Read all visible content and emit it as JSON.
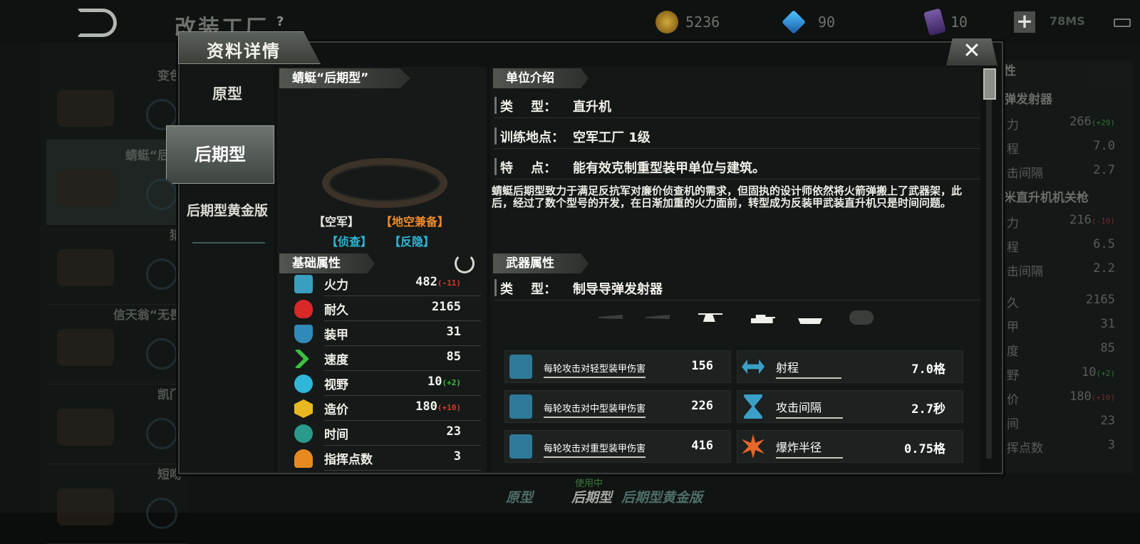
{
  "topbar": {
    "title": "改装工厂",
    "help": "?",
    "gold": "5236",
    "gems": "90",
    "cards": "10",
    "plus": "+",
    "ping": "78MS"
  },
  "bg_list": [
    {
      "name": "变色"
    },
    {
      "name": "蜻蜓“后期"
    },
    {
      "name": "猎"
    },
    {
      "name": "信天翁“无畏"
    },
    {
      "name": "凯门"
    },
    {
      "name": "短吻"
    }
  ],
  "bg_right": {
    "head1": "性",
    "head2": "弹发射器",
    "rows1": [
      {
        "label": "力",
        "value": "266",
        "delta": "(+29)",
        "delta_color": "green"
      },
      {
        "label": "程",
        "value": "7.0"
      },
      {
        "label": "击间隔",
        "value": "2.7"
      }
    ],
    "head3": "米直升机机关枪",
    "rows2": [
      {
        "label": "力",
        "value": "216",
        "delta": "(-10)",
        "delta_color": "red"
      },
      {
        "label": "程",
        "value": "6.5"
      },
      {
        "label": "击间隔",
        "value": "2.2"
      }
    ],
    "rows3": [
      {
        "label": "久",
        "value": "2165"
      },
      {
        "label": "甲",
        "value": "31"
      },
      {
        "label": "度",
        "value": "85"
      },
      {
        "label": "野",
        "value": "10",
        "delta": "(+2)",
        "delta_color": "green"
      },
      {
        "label": "价",
        "value": "180",
        "delta": "(+10)",
        "delta_color": "red"
      },
      {
        "label": "间",
        "value": "23"
      },
      {
        "label": "挥点数",
        "value": "3"
      }
    ]
  },
  "bottom": {
    "using": "使用中",
    "tab1": "原型",
    "tab2": "后期型",
    "tab3": "后期型黄金版"
  },
  "dialog": {
    "title": "资料详情",
    "close": "✕"
  },
  "variants": {
    "prototype": "原型",
    "late": "后期型",
    "late_gold": "后期型黄金版"
  },
  "unit": {
    "name": "蜻蜓“后期型”",
    "tags": [
      {
        "text": "【空军】",
        "color": "#f0f0e8"
      },
      {
        "text": "【地空兼备】",
        "color": "#f08a28"
      },
      {
        "text": "【侦查】",
        "color": "#2fb6d8"
      },
      {
        "text": "【反隐】",
        "color": "#2fb6d8"
      }
    ]
  },
  "base_stats": {
    "header": "基础属性",
    "rows": [
      {
        "label": "火力",
        "value": "482",
        "delta": "(-11)",
        "delta_color": "#d83a2a",
        "icon": "firepower-icon",
        "icon_color": "#3a9ec0"
      },
      {
        "label": "耐久",
        "value": "2165",
        "icon": "heart-icon",
        "icon_color": "#d82828"
      },
      {
        "label": "装甲",
        "value": "31",
        "icon": "armor-shield-icon",
        "icon_color": "#2f8ab8"
      },
      {
        "label": "速度",
        "value": "85",
        "icon": "speed-chevron-icon",
        "icon_color": "#3ac040"
      },
      {
        "label": "视野",
        "value": "10",
        "delta": "(+2)",
        "delta_color": "#3ac040",
        "icon": "eye-icon",
        "icon_color": "#2fb6d8"
      },
      {
        "label": "造价",
        "value": "180",
        "delta": "(+10)",
        "delta_color": "#d83a2a",
        "icon": "cost-cube-icon",
        "icon_color": "#e8b820"
      },
      {
        "label": "时间",
        "value": "23",
        "icon": "clock-icon",
        "icon_color": "#2a9a8a"
      },
      {
        "label": "指挥点数",
        "value": "3",
        "icon": "command-icon",
        "icon_color": "#e88a20"
      }
    ]
  },
  "intro": {
    "header": "单位介绍",
    "rows": [
      {
        "key": "类    型：",
        "value": "直升机"
      },
      {
        "key": "训练地点：",
        "value": "空军工厂 1级"
      },
      {
        "key": "特    点：",
        "value": "能有效克制重型装甲单位与建筑。"
      }
    ],
    "description": "蜻蜓后期型致力于满足反抗军对廉价侦查机的需求，但固执的设计师依然将火箭弹搬上了武器架，此后，经过了数个型号的开发，在日渐加重的火力面前，转型成为反装甲武装直升机只是时间问题。"
  },
  "weapon": {
    "header": "武器属性",
    "type_key": "类    型：",
    "type_value": "制导导弹发射器",
    "targets": [
      {
        "icon": "fighter-jet-icon",
        "active": false
      },
      {
        "icon": "bomber-jet-icon",
        "active": false
      },
      {
        "icon": "helicopter-icon",
        "active": true
      },
      {
        "icon": "tank-icon",
        "active": true
      },
      {
        "icon": "ship-icon",
        "active": true
      },
      {
        "icon": "submarine-icon",
        "active": false
      }
    ],
    "damage": [
      {
        "label": "每轮攻击对轻型装甲伤害",
        "value": "156",
        "icon": "light-armor-icon"
      },
      {
        "label": "每轮攻击对中型装甲伤害",
        "value": "226",
        "icon": "medium-armor-icon"
      },
      {
        "label": "每轮攻击对重型装甲伤害",
        "value": "416",
        "icon": "heavy-armor-icon"
      }
    ],
    "props": [
      {
        "label": "射程",
        "value": "7.0格",
        "icon": "range-arrow-icon"
      },
      {
        "label": "攻击间隔",
        "value": "2.7秒",
        "icon": "hourglass-icon"
      },
      {
        "label": "爆炸半径",
        "value": "0.75格",
        "icon": "explosion-icon"
      }
    ]
  }
}
